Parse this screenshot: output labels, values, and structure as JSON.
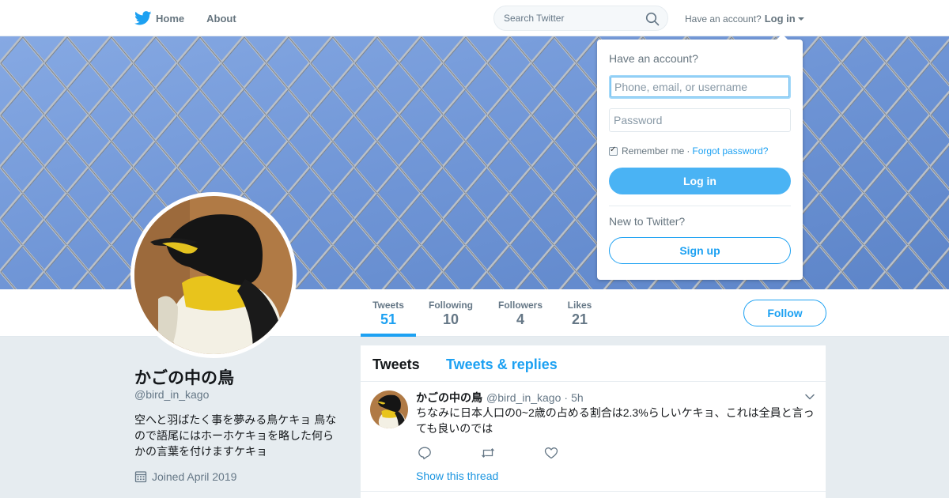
{
  "nav": {
    "home_label": "Home",
    "about_label": "About",
    "search_placeholder": "Search Twitter",
    "have_account": "Have an account?",
    "login_label": "Log in"
  },
  "profile_nav": {
    "stats": [
      {
        "label": "Tweets",
        "value": "51"
      },
      {
        "label": "Following",
        "value": "10"
      },
      {
        "label": "Followers",
        "value": "4"
      },
      {
        "label": "Likes",
        "value": "21"
      }
    ],
    "follow_label": "Follow"
  },
  "profile": {
    "name": "かごの中の鳥",
    "handle": "@bird_in_kago",
    "bio": "空へと羽ばたく事を夢みる鳥ケキョ 鳥なので語尾にはホーホケキョを略した何らかの言葉を付けますケキョ",
    "joined": "Joined April 2019"
  },
  "timeline": {
    "tabs": [
      "Tweets",
      "Tweets & replies"
    ],
    "tweet": {
      "name": "かごの中の鳥",
      "handle": "@bird_in_kago",
      "dot": "·",
      "time": "5h",
      "text": "ちなみに日本人口の0~2歳の占める割合は2.3%らしいケキョ、これは全員と言っても良いのでは",
      "show_thread": "Show this thread"
    }
  },
  "login_dropdown": {
    "title": "Have an account?",
    "username_placeholder": "Phone, email, or username",
    "password_placeholder": "Password",
    "remember_label": "Remember me",
    "separator": "·",
    "forgot_label": "Forgot password?",
    "login_button": "Log in",
    "new_label": "New to Twitter?",
    "signup_button": "Sign up"
  },
  "colors": {
    "accent": "#1da1f2",
    "login_button": "#4ab3f4",
    "page_background": "#e6ecf0"
  },
  "icons": [
    "twitter-bird-icon",
    "search-icon",
    "caret-down-icon",
    "calendar-icon",
    "reply-icon",
    "retweet-icon",
    "like-icon",
    "chevron-down-icon",
    "checkbox-icon"
  ]
}
